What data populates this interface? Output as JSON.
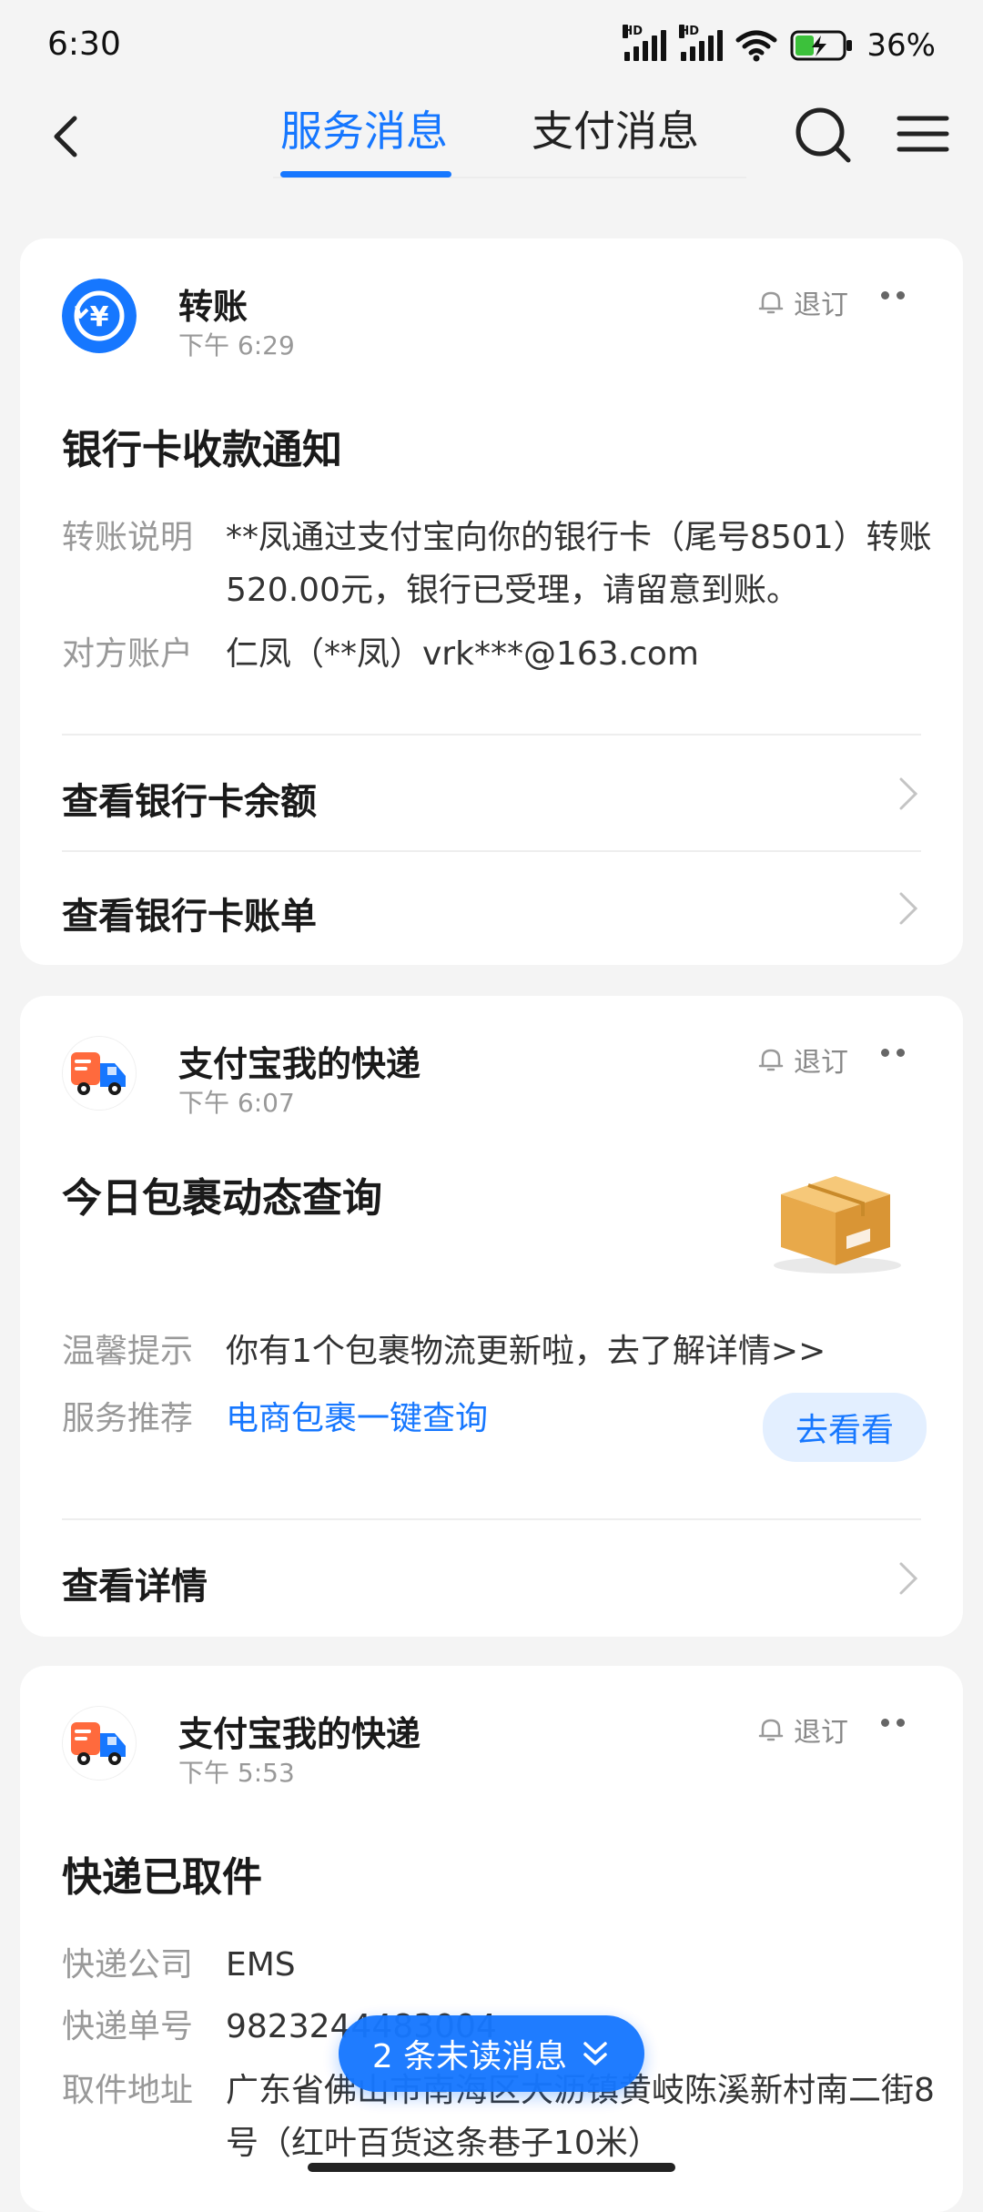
{
  "status": {
    "time": "6:30",
    "battery": "36%",
    "net1": "HD",
    "net2": "HD"
  },
  "nav": {
    "tab_service": "服务消息",
    "tab_payment": "支付消息"
  },
  "cards": [
    {
      "source": "转账",
      "time": "下午 6:29",
      "unsubscribe": "退订",
      "title": "银行卡收款通知",
      "rows": [
        {
          "key": "转账说明",
          "value": "**凤通过支付宝向你的银行卡（尾号8501）转账520.00元，银行已受理，请留意到账。"
        },
        {
          "key": "对方账户",
          "value": "仁凤（**凤）vrk***@163.com"
        }
      ],
      "links": [
        "查看银行卡余额",
        "查看银行卡账单"
      ],
      "accent": "#1677ff"
    },
    {
      "source": "支付宝我的快递",
      "time": "下午 6:07",
      "unsubscribe": "退订",
      "title": "今日包裹动态查询",
      "rows": [
        {
          "key": "温馨提示",
          "value": "你有1个包裹物流更新啦，去了解详情>>"
        },
        {
          "key": "服务推荐",
          "value": "电商包裹一键查询"
        }
      ],
      "action_button": "去看看",
      "links": [
        "查看详情"
      ]
    },
    {
      "source": "支付宝我的快递",
      "time": "下午 5:53",
      "unsubscribe": "退订",
      "title": "快递已取件",
      "rows": [
        {
          "key": "快递公司",
          "value": "EMS"
        },
        {
          "key": "快递单号",
          "value": "9823244483004"
        },
        {
          "key": "取件地址",
          "value": "广东省佛山市南海区大沥镇黄岐陈溪新村南二街8号（红叶百货这条巷子10米）"
        }
      ]
    }
  ],
  "unread_pill": "2 条未读消息",
  "icons": [
    "back-arrow-icon",
    "search-icon",
    "menu-icon",
    "bell-icon",
    "more-icon",
    "chevron-right-icon",
    "yuan-transfer-icon",
    "delivery-truck-icon",
    "package-box-icon",
    "double-chevron-down-icon"
  ]
}
